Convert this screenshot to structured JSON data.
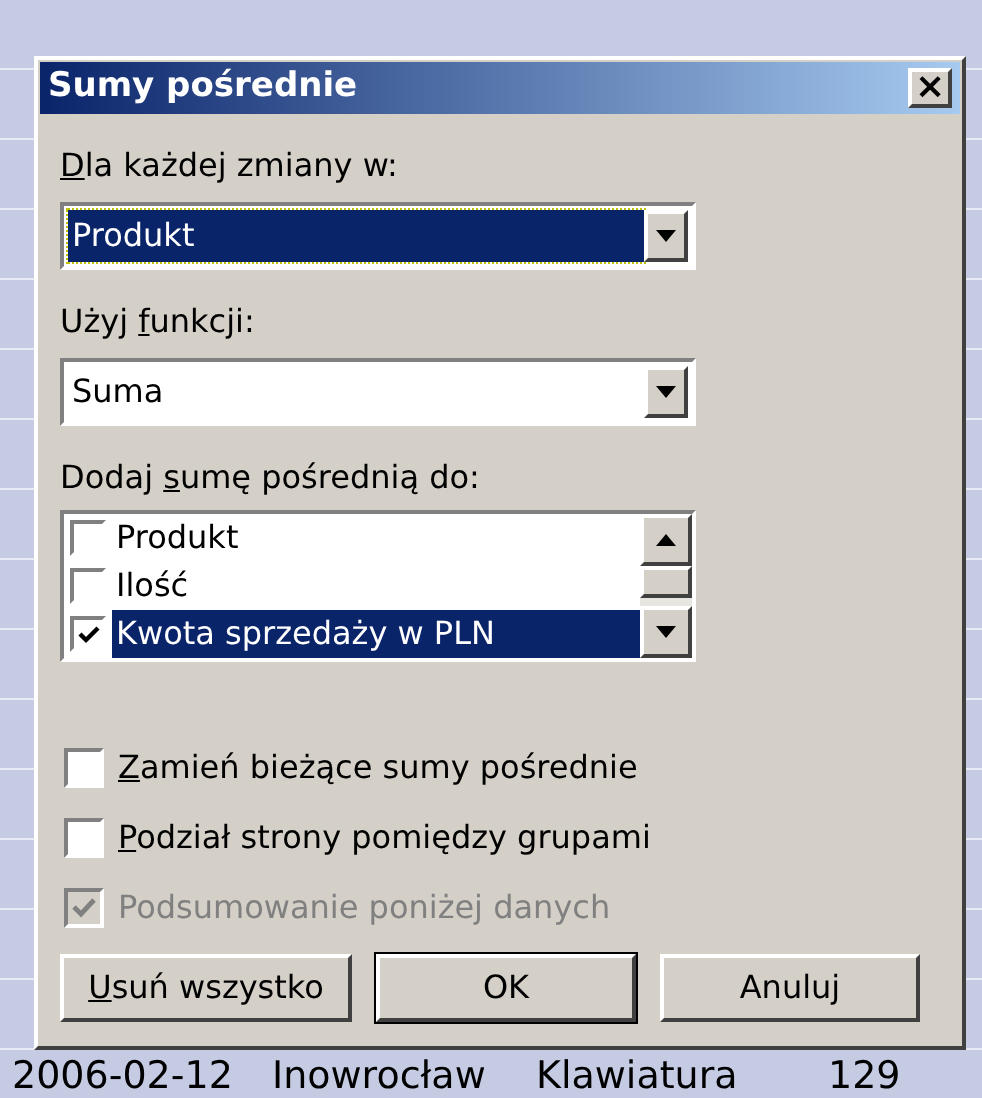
{
  "window": {
    "title": "Sumy pośrednie",
    "close": "×"
  },
  "background_row": {
    "cells": [
      "2006-02-12",
      "Inowrocław",
      "Klawiatura",
      "129"
    ]
  },
  "group_by": {
    "label": [
      {
        "text": "D",
        "underlined": true
      },
      {
        "text": "la każdej zmiany w:",
        "underlined": false
      }
    ],
    "value": "Produkt",
    "focused": true
  },
  "function": {
    "label": [
      {
        "text": "Użyj ",
        "underlined": false
      },
      {
        "text": "f",
        "underlined": true
      },
      {
        "text": "unkcji:",
        "underlined": false
      }
    ],
    "value": "Suma",
    "focused": false
  },
  "add_subtotal_to": {
    "label": [
      {
        "text": "Dodaj ",
        "underlined": false
      },
      {
        "text": "s",
        "underlined": true
      },
      {
        "text": "umę pośrednią do:",
        "underlined": false
      }
    ],
    "items": [
      {
        "label": "Produkt",
        "checked": false,
        "selected": false
      },
      {
        "label": "Ilość",
        "checked": false,
        "selected": false
      },
      {
        "label": "Kwota sprzedaży w PLN",
        "checked": true,
        "selected": true
      }
    ]
  },
  "options": [
    {
      "label": [
        {
          "text": "Z",
          "underlined": true
        },
        {
          "text": "amień bieżące sumy pośrednie",
          "underlined": false
        }
      ],
      "checked": false,
      "disabled": false
    },
    {
      "label": [
        {
          "text": "P",
          "underlined": true
        },
        {
          "text": "odział strony pomiędzy grupami",
          "underlined": false
        }
      ],
      "checked": false,
      "disabled": false
    },
    {
      "label": [
        {
          "text": "Podsumowanie poniżej danych",
          "underlined": false
        }
      ],
      "checked": true,
      "disabled": true
    }
  ],
  "buttons": [
    {
      "label": [
        {
          "text": "U",
          "underlined": true
        },
        {
          "text": "suń wszystko",
          "underlined": false
        }
      ],
      "default": false
    },
    {
      "label": [
        {
          "text": "OK",
          "underlined": false
        }
      ],
      "default": true
    },
    {
      "label": [
        {
          "text": "Anuluj",
          "underlined": false
        }
      ],
      "default": false
    }
  ]
}
